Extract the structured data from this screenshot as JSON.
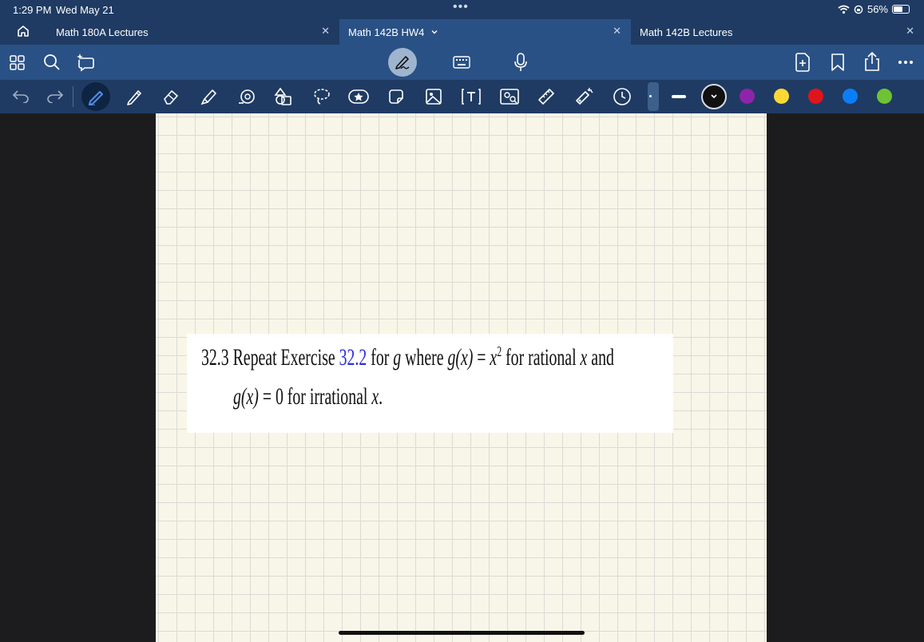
{
  "status": {
    "time": "1:29 PM",
    "date": "Wed May 21",
    "battery": "56%"
  },
  "tabs": [
    {
      "label": "Math 180A Lectures",
      "active": false
    },
    {
      "label": "Math 142B HW4",
      "active": true
    },
    {
      "label": "Math 142B Lectures",
      "active": false
    }
  ],
  "colors": {
    "selected": "#111111",
    "purple": "#8e24aa",
    "yellow": "#fdd835",
    "red": "#e0151b",
    "blue": "#0a7ef7",
    "green": "#6ec335"
  },
  "note": {
    "line1_num": "32.3",
    "line1_a": "Repeat Exercise",
    "line1_ref": "32.2",
    "line1_b": "for",
    "line1_g": "g",
    "line1_c": "where",
    "line1_gx": "g(x)",
    "line1_eq": "=",
    "line1_x": "x",
    "line1_sup": "2",
    "line1_d": "for rational",
    "line1_x2": "x",
    "line1_e": "and",
    "line2_gx": "g(x)",
    "line2_a": "= 0 for irrational",
    "line2_x": "x",
    "line2_end": "."
  }
}
